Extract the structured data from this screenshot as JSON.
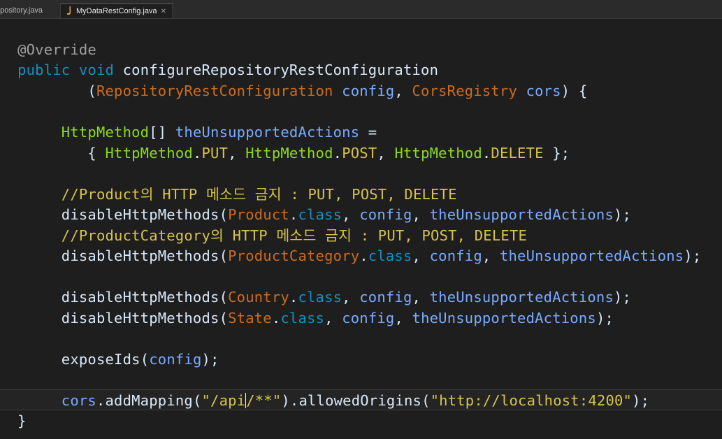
{
  "tabs": [
    {
      "label": "epository.java",
      "active": false
    },
    {
      "label": "MyDataRestConfig.java",
      "active": true,
      "close": "✕"
    }
  ],
  "colors": {
    "background": "#1e1e1e",
    "keyword": "#cc6c1d",
    "type": "#1290c3",
    "class_ref": "#d8c34a",
    "method": "#1ed3e9",
    "variable": "#79abff",
    "field": "#8dda1f",
    "string": "#17c6a3",
    "annotation": "#a0a0a0"
  },
  "code": {
    "l1": {
      "annotation": "@Override"
    },
    "l2": {
      "kw1": "public",
      "kw2": "void",
      "method": "configureRepositoryRestConfiguration"
    },
    "l3": {
      "open": "(",
      "type1": "RepositoryRestConfiguration",
      "p1": "config",
      "comma": ",",
      "type2": "CorsRegistry",
      "p2": "cors",
      "close": ") {"
    },
    "l4": {},
    "l5": {
      "type": "HttpMethod",
      "arr": "[]",
      "var": "theUnsupportedActions",
      "eq": "="
    },
    "l6": {
      "open": "{",
      "t1": "HttpMethod",
      "f1": "PUT",
      "t2": "HttpMethod",
      "f2": "POST",
      "t3": "HttpMethod",
      "f3": "DELETE",
      "close": "};"
    },
    "l7": {},
    "l8": {
      "comment": "//Product의 HTTP 메소드 금지 : PUT, POST, DELETE"
    },
    "l9": {
      "method": "disableHttpMethods",
      "cls": "Product",
      "kwclass": "class",
      "p1": "config",
      "p2": "theUnsupportedActions",
      "end": ");"
    },
    "l10": {
      "comment": "//ProductCategory의 HTTP 메소드 금지 : PUT, POST, DELETE"
    },
    "l11": {
      "method": "disableHttpMethods",
      "cls": "ProductCategory",
      "kwclass": "class",
      "p1": "config",
      "p2": "theUnsupportedActions",
      "end": ");"
    },
    "l12": {},
    "l13": {
      "method": "disableHttpMethods",
      "cls": "Country",
      "kwclass": "class",
      "p1": "config",
      "p2": "theUnsupportedActions",
      "end": ");"
    },
    "l14": {
      "method": "disableHttpMethods",
      "cls": "State",
      "kwclass": "class",
      "p1": "config",
      "p2": "theUnsupportedActions",
      "end": ");"
    },
    "l15": {},
    "l16": {
      "method": "exposeIds",
      "p1": "config",
      "end": ");"
    },
    "l17": {},
    "l18": {
      "var": "cors",
      "m1": "addMapping",
      "s1a": "\"/api",
      "s1b": "/**\"",
      "m2": "allowedOrigins",
      "s2": "\"http://localhost:4200\"",
      "end": ");"
    },
    "l19": {
      "brace": "}"
    }
  }
}
